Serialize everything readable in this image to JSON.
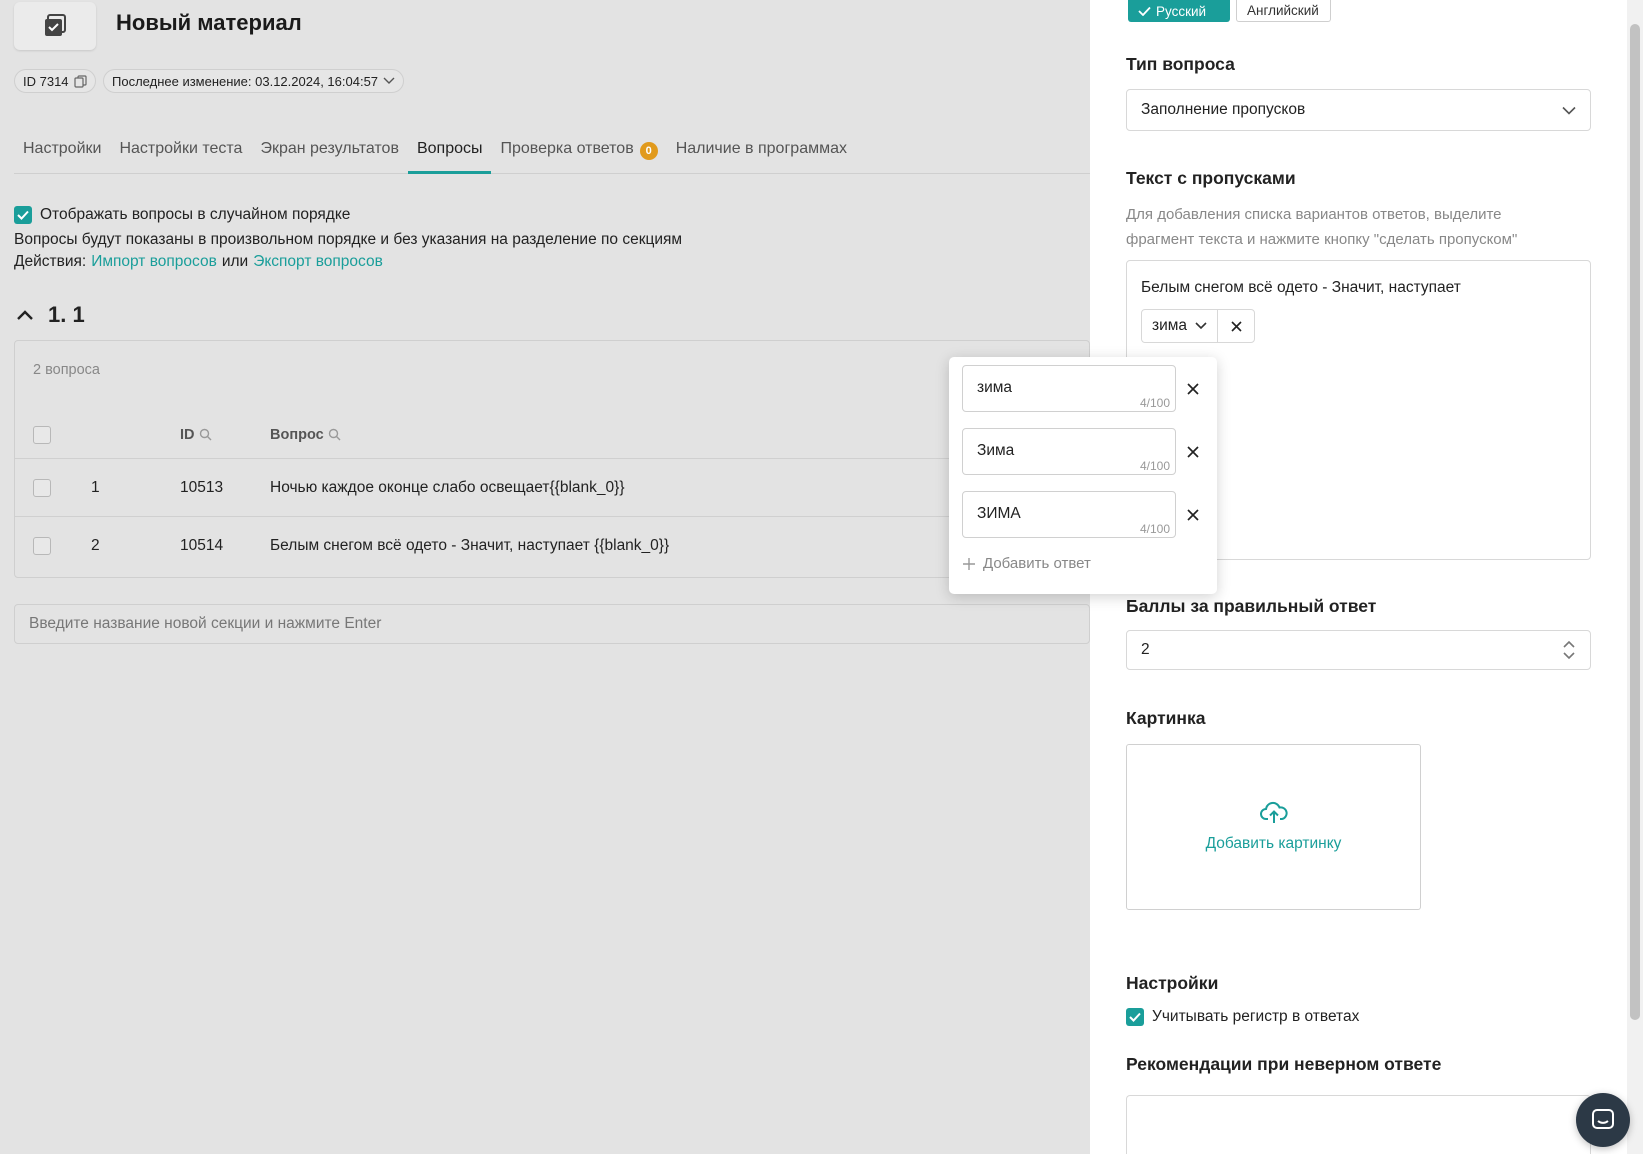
{
  "header": {
    "title": "Новый материал",
    "id_label": "ID 7314",
    "last_modified": "Последнее изменение: 03.12.2024, 16:04:57"
  },
  "tabs": [
    {
      "label": "Настройки"
    },
    {
      "label": "Настройки теста"
    },
    {
      "label": "Экран результатов"
    },
    {
      "label": "Вопросы",
      "active": true
    },
    {
      "label": "Проверка ответов",
      "badge": "0"
    },
    {
      "label": "Наличие в программах"
    }
  ],
  "options": {
    "random_order_label": "Отображать вопросы в случайном порядке",
    "random_order_checked": true,
    "note": "Вопросы будут показаны в произвольном порядке и без указания на разделение по секциям",
    "actions_prefix": "Действия:",
    "import_link": "Импорт вопросов",
    "or_text": "или",
    "export_link": "Экспорт вопросов"
  },
  "section": {
    "title": "1. 1",
    "count": "2 вопроса",
    "columns": {
      "id": "ID",
      "question": "Вопрос"
    },
    "rows": [
      {
        "num": "1",
        "id": "10513",
        "question": "Ночью каждое оконце слабо освещает{{blank_0}}"
      },
      {
        "num": "2",
        "id": "10514",
        "question": "Белым снегом всё одето - Значит, наступает {{blank_0}}"
      }
    ],
    "new_section_placeholder": "Введите название новой секции и нажмите Enter"
  },
  "languages": {
    "active": "Русский",
    "other": "Английский"
  },
  "editor": {
    "question_type_label": "Тип вопроса",
    "question_type_value": "Заполнение пропусков",
    "blank_text_label": "Текст с пропусками",
    "blank_text_hint": "Для добавления списка вариантов ответов, выделите фрагмент текста и нажмите кнопку \"сделать пропуском\"",
    "blank_text_value": "Белым снегом всё одето - Значит, наступает",
    "blank_chip": "зима",
    "points_label": "Баллы за правильный ответ",
    "points_value": "2",
    "image_label": "Картинка",
    "add_image": "Добавить картинку",
    "settings_label": "Настройки",
    "case_sensitive_label": "Учитывать регистр в ответах",
    "case_sensitive_checked": true,
    "recommendations_label": "Рекомендации при неверном ответе"
  },
  "answers_popup": {
    "answers": [
      {
        "value": "зима",
        "counter": "4/100"
      },
      {
        "value": "Зима",
        "counter": "4/100"
      },
      {
        "value": "ЗИМА",
        "counter": "4/100"
      }
    ],
    "add_answer": "Добавить ответ"
  },
  "colors": {
    "accent": "#1a9e9a",
    "badge": "#e19a1c"
  }
}
